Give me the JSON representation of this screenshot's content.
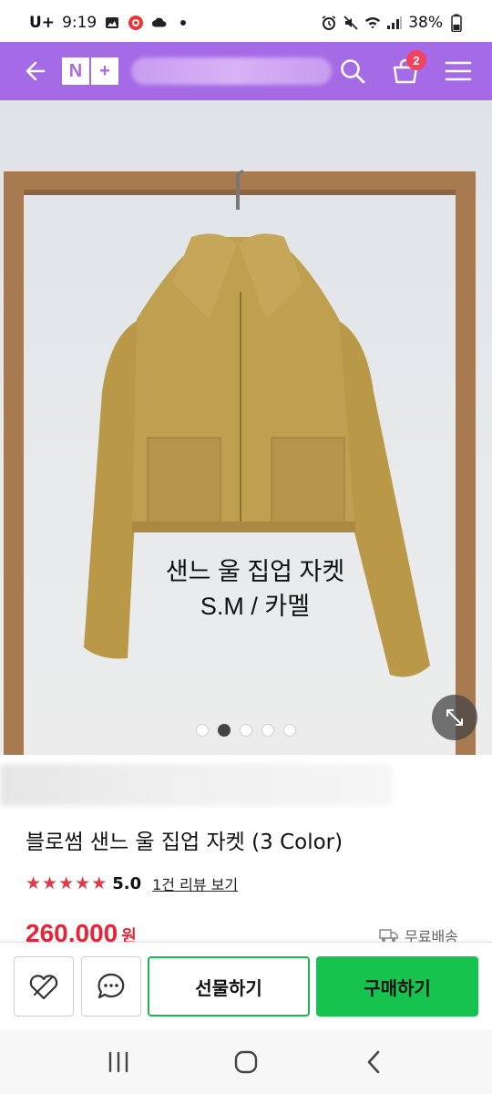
{
  "status_bar": {
    "carrier": "U+",
    "time": "9:19",
    "battery": "38%"
  },
  "header": {
    "logo_n": "N",
    "logo_plus": "+",
    "cart_count": "2",
    "icons": [
      "back-arrow-icon",
      "search-icon",
      "cart-icon",
      "menu-icon"
    ]
  },
  "image": {
    "caption_line1": "샌느 울 집업 자켓",
    "caption_line2": "S.M / 카멜",
    "dot_count": 5,
    "active_dot": 1
  },
  "product": {
    "title": "블로썸 샌느 울 집업 자켓 (3 Color)",
    "rating": "5.0",
    "star_count": 5,
    "review_link": "1건 리뷰 보기",
    "price": "260,000",
    "price_unit": "원",
    "shipping": "무료배송"
  },
  "actions": {
    "gift_label": "선물하기",
    "buy_label": "구매하기"
  },
  "colors": {
    "header": "#a56be6",
    "price": "#e6243a",
    "buy_button": "#17c34f",
    "star": "#e03a47"
  }
}
